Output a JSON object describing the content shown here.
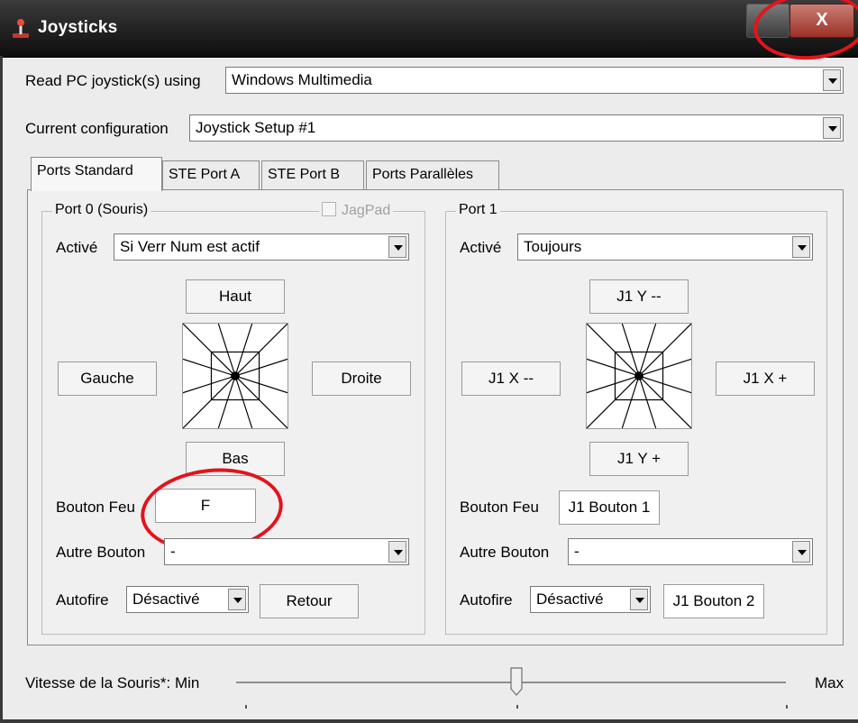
{
  "window": {
    "title": "Joysticks",
    "close_glyph": "X"
  },
  "read_pc": {
    "label": "Read PC joystick(s) using",
    "value": "Windows Multimedia"
  },
  "current_config": {
    "label": "Current configuration",
    "value": "Joystick Setup #1"
  },
  "tabs": [
    {
      "label": "Ports Standard"
    },
    {
      "label": "STE Port A"
    },
    {
      "label": "STE Port B"
    },
    {
      "label": "Ports Parallèles"
    }
  ],
  "port0": {
    "title": "Port 0 (Souris)",
    "jagpad_label": "JagPad",
    "active_label": "Activé",
    "active_value": "Si Verr Num est actif",
    "up": "Haut",
    "left": "Gauche",
    "right": "Droite",
    "down": "Bas",
    "fire_label": "Bouton Feu",
    "fire_value": "F",
    "other_label": "Autre Bouton",
    "other_value": "-",
    "autofire_label": "Autofire",
    "autofire_value": "Désactivé",
    "return_value": "Retour"
  },
  "port1": {
    "title": "Port 1",
    "active_label": "Activé",
    "active_value": "Toujours",
    "up": "J1 Y --",
    "left": "J1 X --",
    "right": "J1 X +",
    "down": "J1 Y +",
    "fire_label": "Bouton Feu",
    "fire_value": "J1 Bouton 1",
    "other_label": "Autre Bouton",
    "other_value": "-",
    "autofire_label": "Autofire",
    "autofire_value": "Désactivé",
    "button2_value": "J1 Bouton 2"
  },
  "mouse_speed": {
    "label": "Vitesse de la Souris*: Min",
    "max_label": "Max",
    "level_fraction": 0.5
  },
  "colors": {
    "annotation": "#e3141b",
    "titlebar": "#1a1a1a",
    "close": "#b4463a"
  }
}
